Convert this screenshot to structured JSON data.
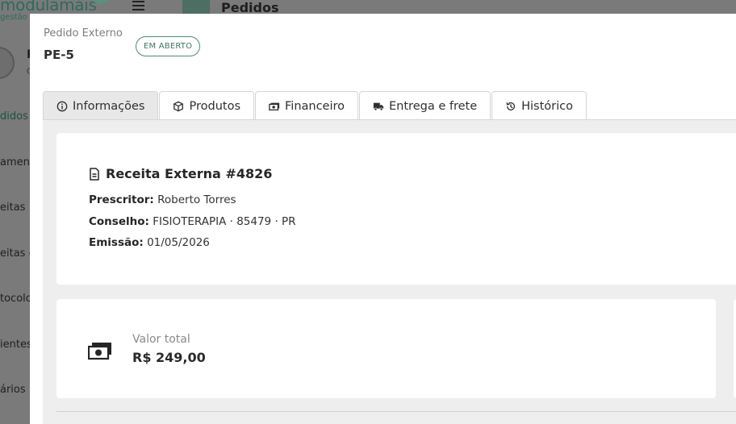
{
  "background": {
    "logo_text": "modulamais",
    "logo_sub": "gestão",
    "user_initial": "F",
    "user_sub": "C",
    "nav": [
      "didos",
      "amen",
      "eitas",
      "eitas e",
      "tocolo",
      "ientes",
      "ários"
    ],
    "page_title": "Pedidos"
  },
  "modal": {
    "ext_label": "Pedido Externo",
    "ext_code": "PE-5",
    "status": "EM ABERTO"
  },
  "tabs": [
    {
      "label": "Informações",
      "icon": "info-icon"
    },
    {
      "label": "Produtos",
      "icon": "box-icon"
    },
    {
      "label": "Financeiro",
      "icon": "money-icon"
    },
    {
      "label": "Entrega e frete",
      "icon": "truck-icon"
    },
    {
      "label": "Histórico",
      "icon": "history-icon"
    }
  ],
  "receita": {
    "title": "Receita Externa #4826",
    "prescritor_label": "Prescritor:",
    "prescritor": "Roberto Torres",
    "conselho_label": "Conselho:",
    "conselho": "FISIOTERAPIA · 85479 · PR",
    "emissao_label": "Emissão:",
    "emissao": "01/05/2026"
  },
  "valor": {
    "label": "Valor total",
    "value": "R$ 249,00"
  }
}
